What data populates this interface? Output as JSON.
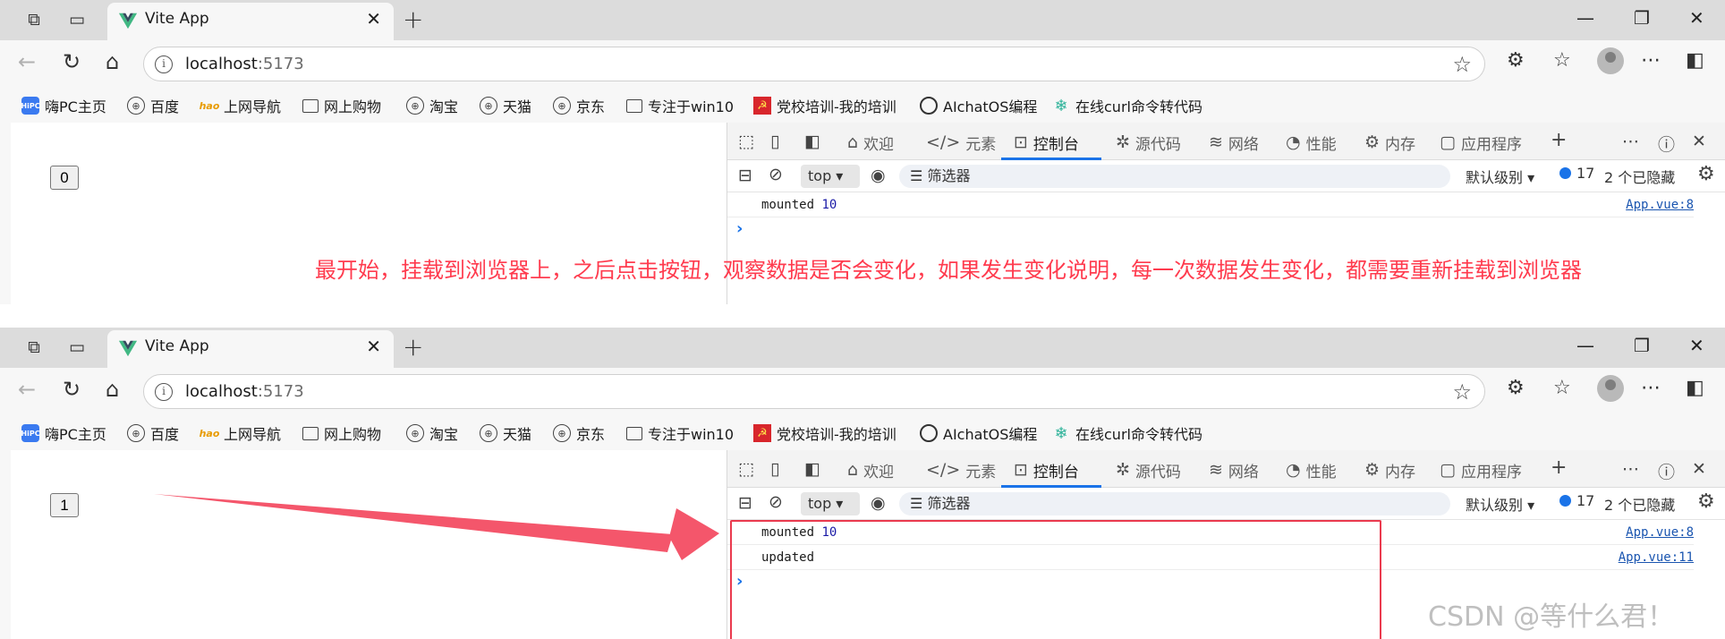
{
  "browser": {
    "tab_title": "Vite App",
    "url_host": "localhost",
    "url_port": ":5173"
  },
  "bookmarks": [
    {
      "label": "嗨PC主页",
      "icon": "hipc-icon"
    },
    {
      "label": "百度",
      "icon": "globe-icon"
    },
    {
      "label": "上网导航",
      "icon": "hao-icon"
    },
    {
      "label": "网上购物",
      "icon": "folder-icon"
    },
    {
      "label": "淘宝",
      "icon": "globe-icon"
    },
    {
      "label": "天猫",
      "icon": "globe-icon"
    },
    {
      "label": "京东",
      "icon": "globe-icon"
    },
    {
      "label": "专注于win10",
      "icon": "folder-icon"
    },
    {
      "label": "党校培训-我的培训",
      "icon": "party-emblem-icon"
    },
    {
      "label": "AIchatOS编程",
      "icon": "chatgpt-icon"
    },
    {
      "label": "在线curl命令转代码",
      "icon": "snowflake-icon"
    }
  ],
  "devtools": {
    "tabs": [
      "欢迎",
      "元素",
      "控制台",
      "源代码",
      "网络",
      "性能",
      "内存",
      "应用程序"
    ],
    "active_tab": "控制台",
    "context": "top",
    "filter_placeholder": "筛选器",
    "levels": "默认级别",
    "message_count": "17",
    "hidden_count": "2 个已隐藏"
  },
  "before": {
    "counter_value": "0",
    "logs": [
      {
        "prefix": "mounted",
        "value": "10",
        "source": "App.vue:8"
      }
    ]
  },
  "after": {
    "counter_value": "1",
    "logs": [
      {
        "prefix": "mounted",
        "value": "10",
        "source": "App.vue:8"
      },
      {
        "prefix": "updated",
        "value": "",
        "source": "App.vue:11"
      }
    ]
  },
  "annotation": "最开始，挂载到浏览器上，之后点击按钮，观察数据是否会变化，如果发生变化说明，每一次数据发生变化，都需要重新挂载到浏览器",
  "watermark": "CSDN @等什么君！",
  "colors": {
    "annotation": "#ff3b4e",
    "active_tab_underline": "#1a73e8",
    "vue_green": "#41b883"
  }
}
